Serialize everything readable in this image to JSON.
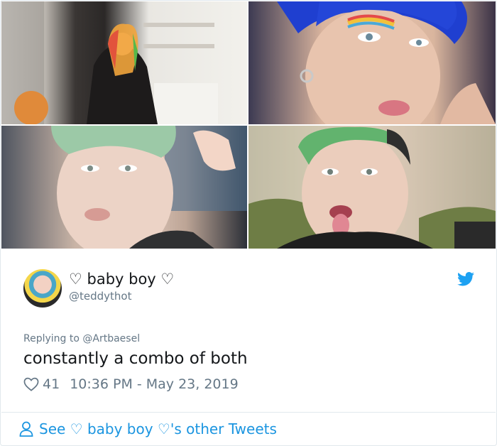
{
  "tweet": {
    "display_name": "♡ baby boy ♡",
    "handle": "@teddythot",
    "replying_prefix": "Replying to",
    "replying_to": "@Artbaesel",
    "text": "constantly a combo of both",
    "likes": "41",
    "timestamp": "10:36 PM - May 23, 2019",
    "more_link": "See ♡ baby boy ♡'s other Tweets"
  },
  "colors": {
    "accent": "#1b95e0",
    "muted": "#657786",
    "text": "#14171a",
    "border": "#e1e8ed"
  },
  "icons": {
    "brand": "twitter-bird-icon",
    "like": "heart-icon",
    "profile": "person-icon"
  }
}
